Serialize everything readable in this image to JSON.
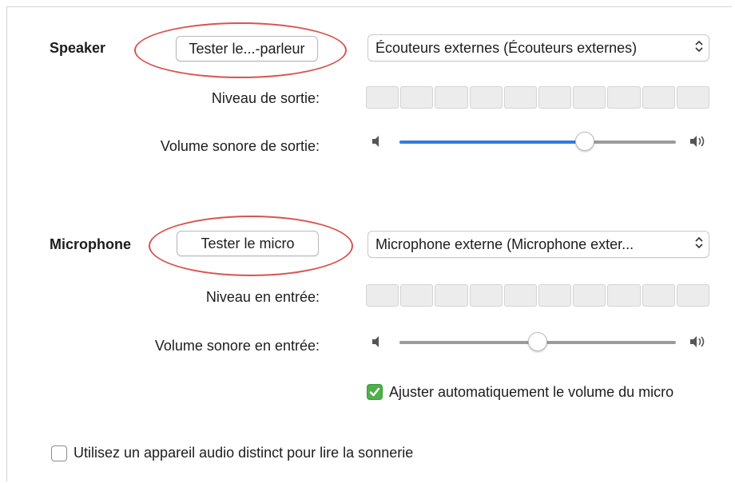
{
  "speaker": {
    "section_label": "Speaker",
    "test_button": "Tester le...-parleur",
    "device_select": "Écouteurs externes (Écouteurs externes)",
    "level_label": "Niveau de sortie:",
    "volume_label": "Volume sonore de sortie:",
    "volume_level": 0.67,
    "meter_segments": 10
  },
  "microphone": {
    "section_label": "Microphone",
    "test_button": "Tester le micro",
    "device_select": "Microphone externe (Microphone exter...",
    "level_label": "Niveau en entrée:",
    "volume_label": "Volume sonore en entrée:",
    "volume_level": 0.5,
    "meter_segments": 10,
    "auto_adjust_label": "Ajuster automatiquement le volume du micro",
    "auto_adjust_checked": true
  },
  "ringtone": {
    "label": "Utilisez un appareil audio distinct pour lire la sonnerie",
    "checked": false
  },
  "colors": {
    "annotation_ellipse": "#d9534f",
    "slider_fill": "#2f7de1",
    "checkbox_checked": "#4fb04b"
  },
  "icons": {
    "chevron": "up-down-chevron-icon",
    "volume_low": "speaker-low-icon",
    "volume_high": "speaker-high-icon",
    "check": "checkmark-icon"
  }
}
